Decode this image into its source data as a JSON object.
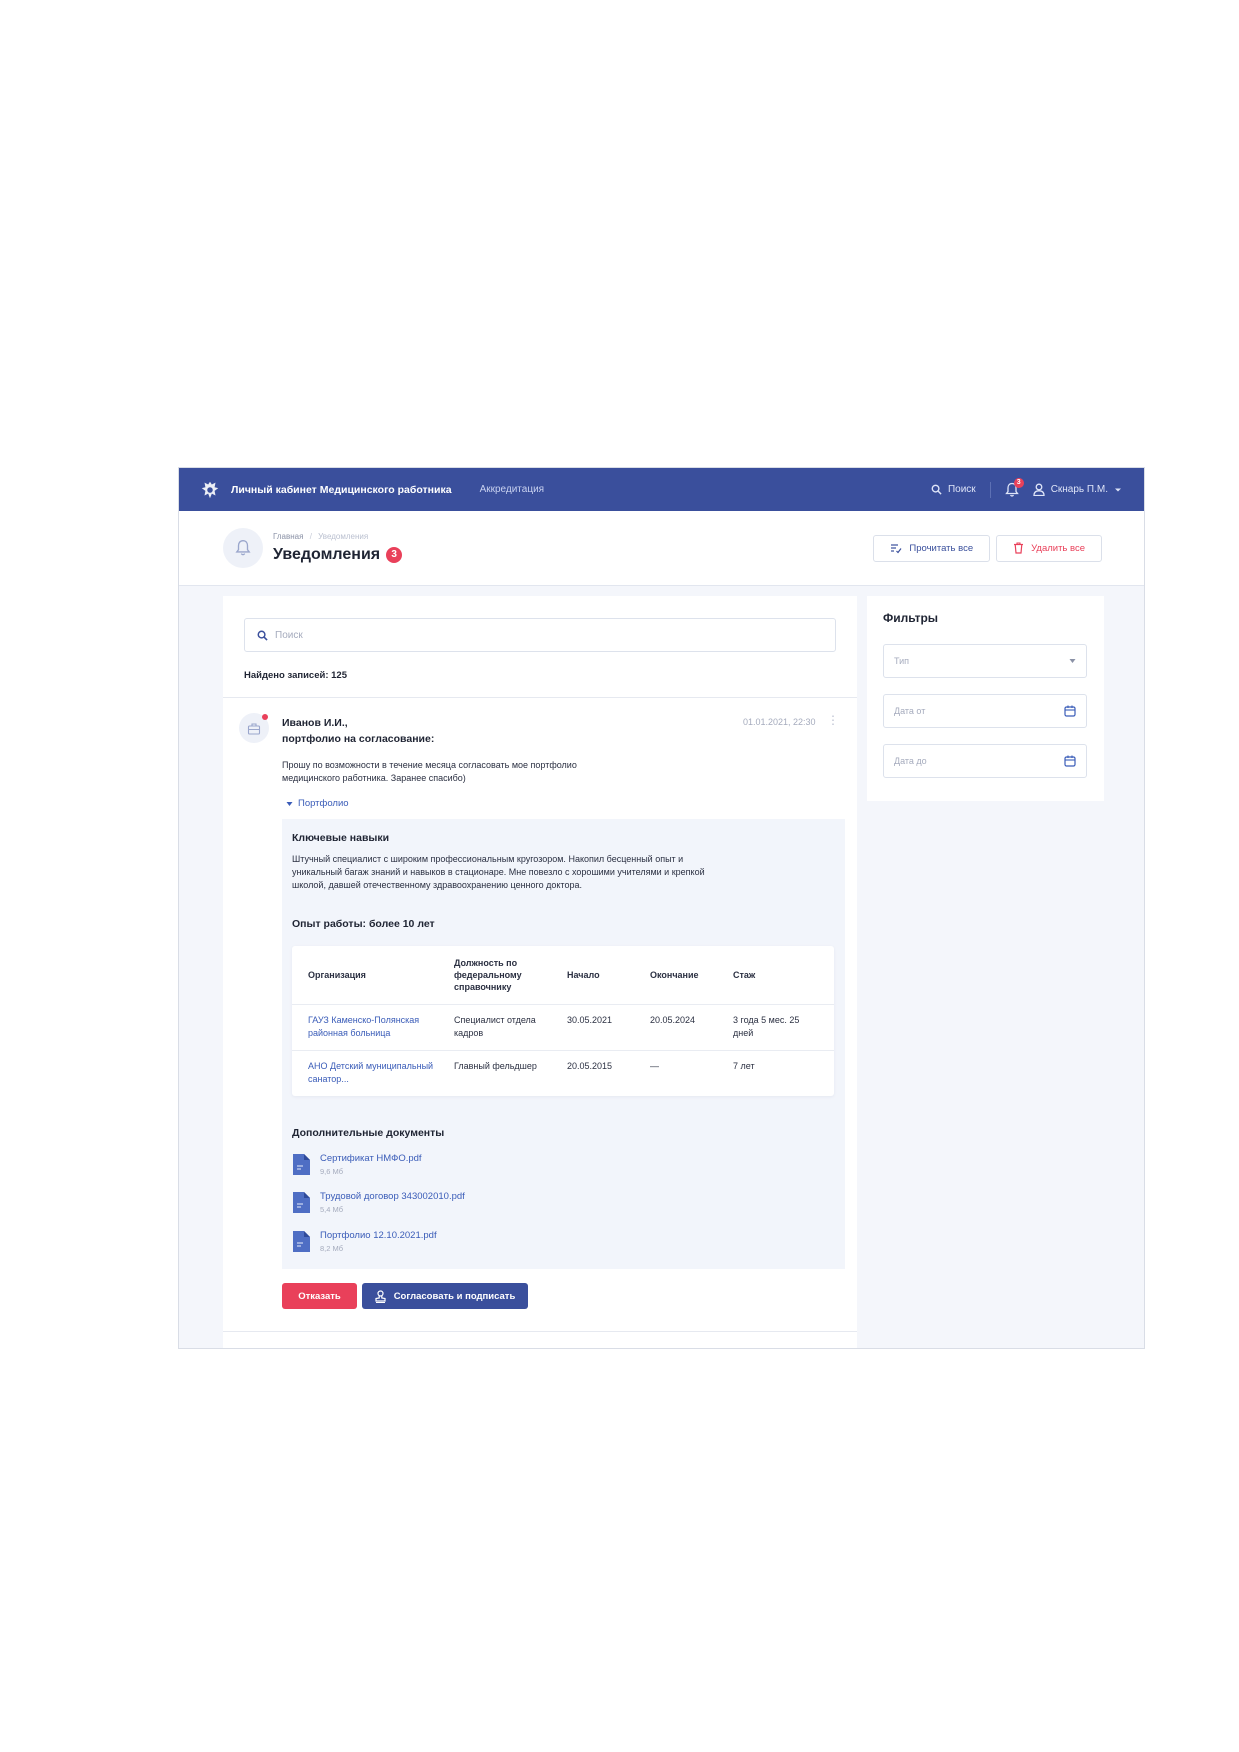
{
  "topbar": {
    "app_title": "Личный кабинет Медицинского работника",
    "nav_item": "Аккредитация",
    "search_label": "Поиск",
    "notifications_count": "3",
    "user_name": "Скнарь П.М."
  },
  "header": {
    "breadcrumb_home": "Главная",
    "breadcrumb_separator": "/",
    "breadcrumb_current": "Уведомления",
    "title": "Уведомления",
    "title_badge": "3",
    "read_all_label": "Прочитать все",
    "delete_all_label": "Удалить все"
  },
  "main": {
    "search_placeholder": "Поиск",
    "found_label": "Найдено записей: 125"
  },
  "message": {
    "author": "Иванов И.И.,",
    "subject": "портфолио на согласование:",
    "date": "01.01.2021, 22:30",
    "body": "Прошу по возможности в течение месяца согласовать мое портфолио медицинского работника. Заранее спасибо)",
    "portfolio_toggle": "Портфолио",
    "skills_title": "Ключевые навыки",
    "skills_text": "Штучный специалист с широким профессиональным кругозором. Накопил бесценный опыт и уникальный багаж знаний и навыков в стационаре. Мне повезло с хорошими учителями и крепкой школой, давшей отечественному здравоохранению ценного доктора.",
    "experience_title": "Опыт работы: более 10 лет",
    "table": {
      "headers": [
        "Организация",
        "Должность по федеральному справочнику",
        "Начало",
        "Окончание",
        "Стаж"
      ],
      "rows": [
        [
          "ГАУЗ Каменско-Полянская районная больница",
          "Специалист отдела кадров",
          "30.05.2021",
          "20.05.2024",
          "3 года 5 мес. 25 дней"
        ],
        [
          "АНО Детский муниципальный санатор...",
          "Главный фельдшер",
          "20.05.2015",
          "—",
          "7 лет"
        ]
      ]
    },
    "docs_title": "Дополнительные документы",
    "documents": [
      {
        "name": "Сертификат НМФО.pdf",
        "size": "9,6 Мб"
      },
      {
        "name": "Трудовой договор 343002010.pdf",
        "size": "5,4 Мб"
      },
      {
        "name": "Портфолио 12.10.2021.pdf",
        "size": "8,2 Мб"
      }
    ],
    "reject_label": "Отказать",
    "sign_label": "Согласовать и подписать"
  },
  "filters": {
    "title": "Фильтры",
    "type_placeholder": "Тип",
    "date_from_placeholder": "Дата от",
    "date_to_placeholder": "Дата до"
  },
  "colors": {
    "primary": "#3a4f9c",
    "danger": "#e9405a",
    "link": "#3a5cb8",
    "background": "#f4f6fb"
  }
}
